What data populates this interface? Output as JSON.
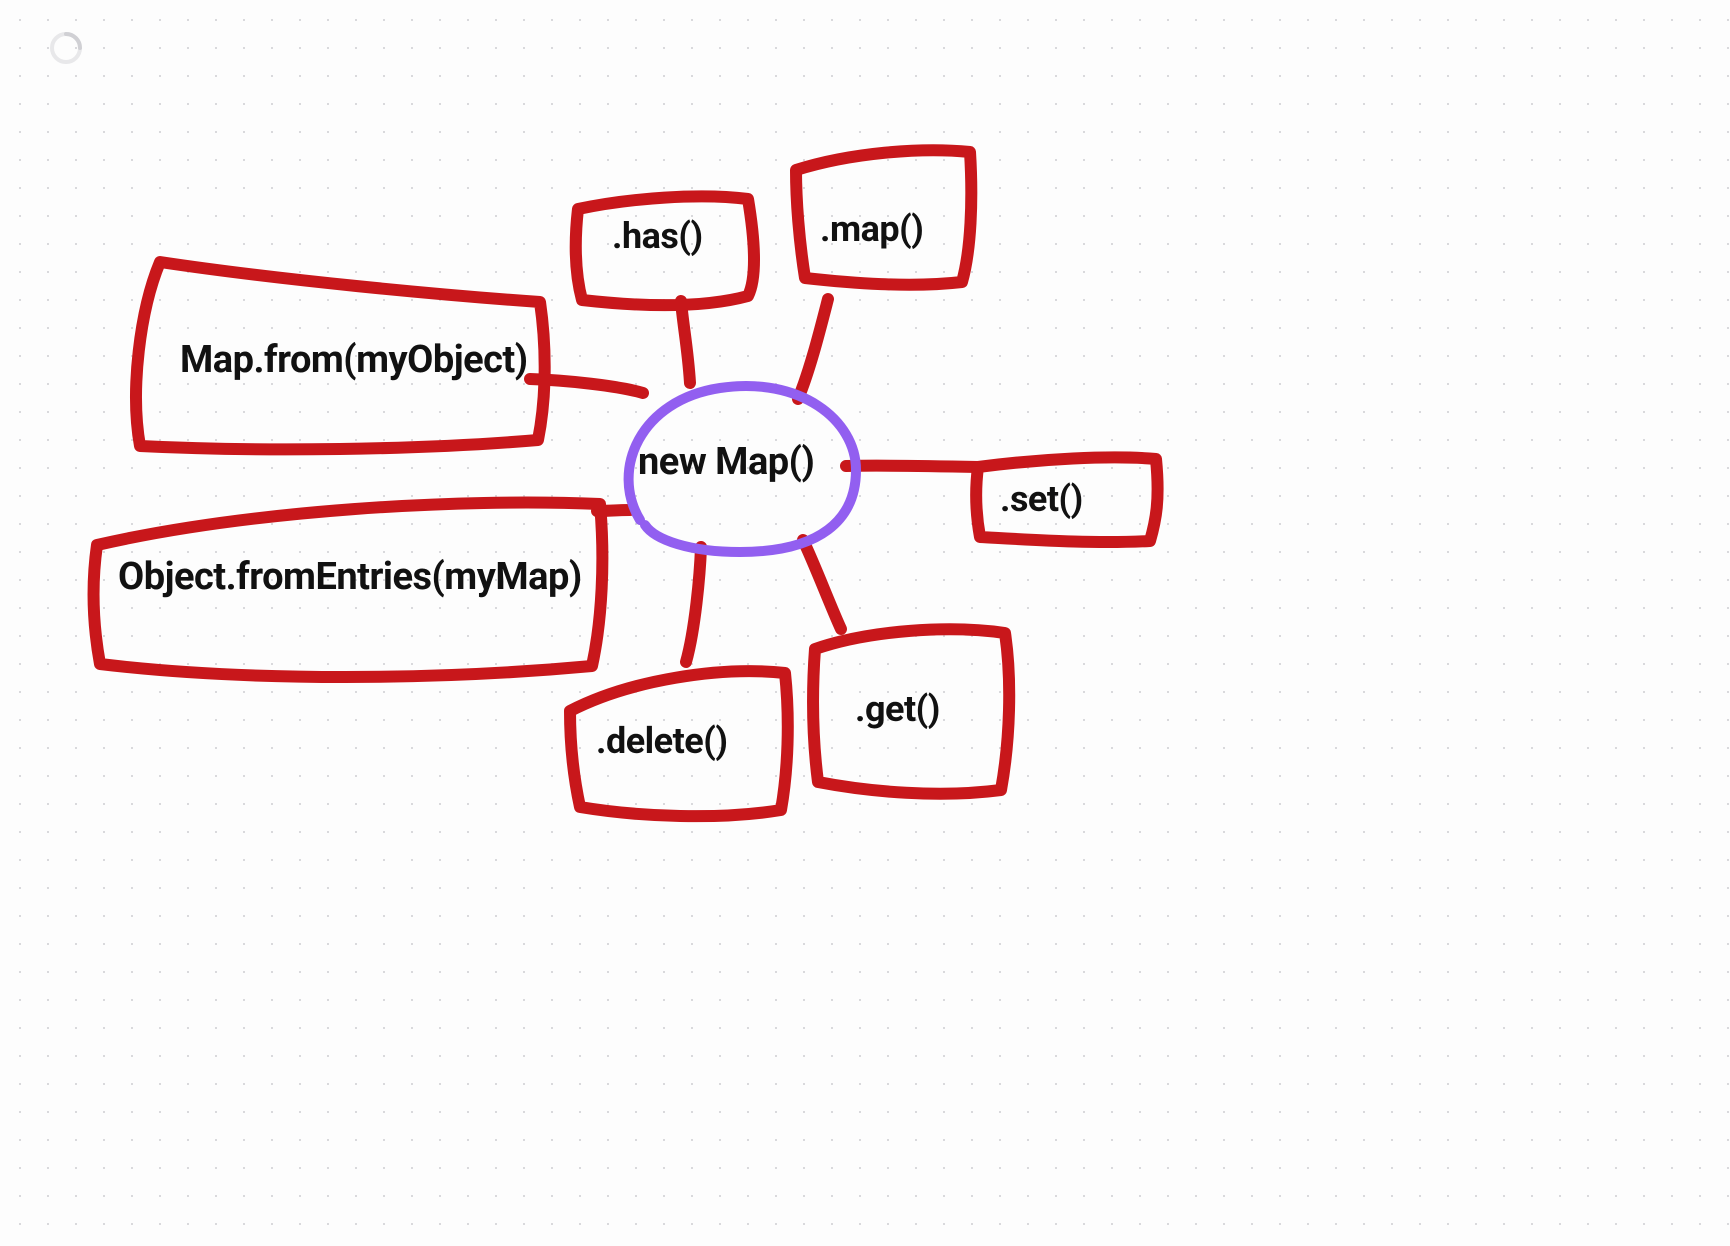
{
  "diagram": {
    "center": "new Map()",
    "nodes": {
      "has": ".has()",
      "map": ".map()",
      "set": ".set()",
      "get": ".get()",
      "delete": ".delete()",
      "map_from": "Map.from(myObject)",
      "object_from_entries": "Object.fromEntries(myMap)"
    },
    "colors": {
      "stroke_red": "#c8171b",
      "stroke_purple": "#925ff0",
      "text": "#111111",
      "dot_grid": "#d9d9dc"
    }
  }
}
